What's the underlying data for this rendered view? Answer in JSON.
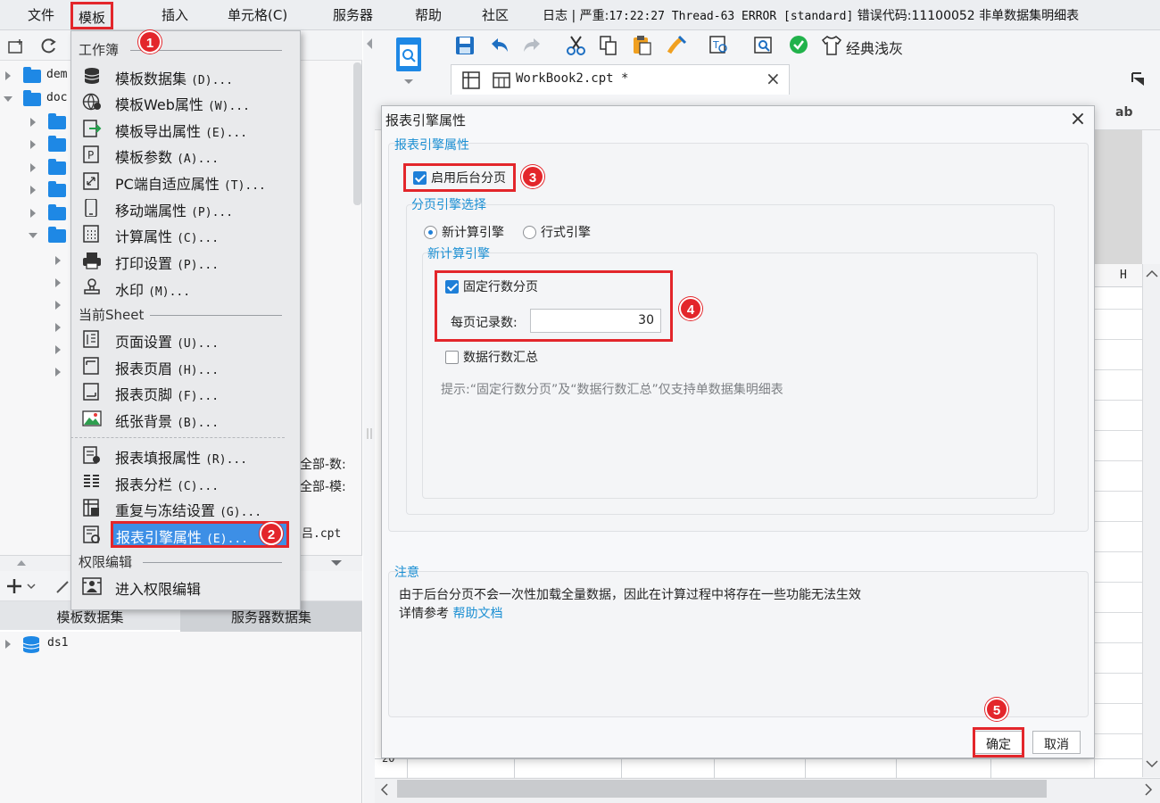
{
  "menubar": {
    "items": [
      "文件",
      "模板",
      "插入",
      "单元格(C)",
      "服务器",
      "帮助",
      "社区"
    ],
    "status_prefix": "日志 | 严重:",
    "status_mono": "17:22:27 Thread-63 ERROR [standard]",
    "status_suffix": " 错误代码:11100052 非单数据集明细表"
  },
  "left_panel": {
    "tree": [
      {
        "label": "dem",
        "expanded": false
      },
      {
        "label": "doc",
        "expanded": true
      },
      {
        "label": "",
        "expanded": false
      },
      {
        "label": "",
        "expanded": false
      },
      {
        "label": "",
        "expanded": false
      },
      {
        "label": "",
        "expanded": false
      },
      {
        "label": "",
        "expanded": true
      }
    ],
    "file_partials": [
      "全部-数:",
      "全部-模:",
      "吕.cpt"
    ],
    "ds_tabs": [
      "模板数据集",
      "服务器数据集"
    ],
    "datasets": [
      "ds1"
    ]
  },
  "dropdown": {
    "section_workbook": "工作簿",
    "section_sheet": "当前Sheet",
    "section_perm": "权限编辑",
    "workbook_items": [
      {
        "label": "模板数据集",
        "key": "(D)..."
      },
      {
        "label": "模板Web属性",
        "key": "(W)..."
      },
      {
        "label": "模板导出属性",
        "key": "(E)..."
      },
      {
        "label": "模板参数",
        "key": "(A)..."
      },
      {
        "label": "PC端自适应属性",
        "key": "(T)..."
      },
      {
        "label": "移动端属性",
        "key": "(P)..."
      },
      {
        "label": "计算属性",
        "key": "(C)..."
      },
      {
        "label": "打印设置",
        "key": "(P)..."
      },
      {
        "label": "水印",
        "key": "(M)..."
      }
    ],
    "sheet_items": [
      {
        "label": "页面设置",
        "key": "(U)..."
      },
      {
        "label": "报表页眉",
        "key": "(H)..."
      },
      {
        "label": "报表页脚",
        "key": "(F)..."
      },
      {
        "label": "纸张背景",
        "key": "(B)..."
      }
    ],
    "report_items": [
      {
        "label": "报表填报属性",
        "key": "(R)..."
      },
      {
        "label": "报表分栏",
        "key": "(C)..."
      },
      {
        "label": "重复与冻结设置",
        "key": "(G)..."
      },
      {
        "label": "报表引擎属性",
        "key": "(E)..."
      }
    ],
    "perm_items": [
      {
        "label": "进入权限编辑",
        "key": ""
      }
    ]
  },
  "toolbar": {
    "theme_label": "经典浅灰"
  },
  "tab": {
    "label": "WorkBook2.cpt *",
    "close": "×"
  },
  "grid": {
    "column_h": "H",
    "row_20": "20",
    "format_ab": "ab"
  },
  "dialog": {
    "title": "报表引擎属性",
    "close": "×",
    "group_title": "报表引擎属性",
    "enable_backend_paging": "启用后台分页",
    "paging_engine_title": "分页引擎选择",
    "radio_new": "新计算引擎",
    "radio_row": "行式引擎",
    "new_engine_title": "新计算引擎",
    "fixed_rows_paging": "固定行数分页",
    "rows_per_page_label": "每页记录数:",
    "rows_per_page_value": "30",
    "data_row_summary": "数据行数汇总",
    "hint": "提示:“固定行数分页”及“数据行数汇总”仅支持单数据集明细表",
    "note_title": "注意",
    "note_line1": "由于后台分页不会一次性加载全量数据，因此在计算过程中将存在一些功能无法生效",
    "note_line2_prefix": "详情参考 ",
    "note_link": "帮助文档",
    "ok": "确定",
    "cancel": "取消"
  },
  "badges": [
    "1",
    "2",
    "3",
    "4",
    "5"
  ],
  "colors": {
    "accent_red": "#e3262b",
    "highlight_blue": "#3d8fe6",
    "link_blue": "#1b8fd3",
    "checkbox_blue": "#1e7fd8",
    "folder_blue": "#1e88e5"
  }
}
